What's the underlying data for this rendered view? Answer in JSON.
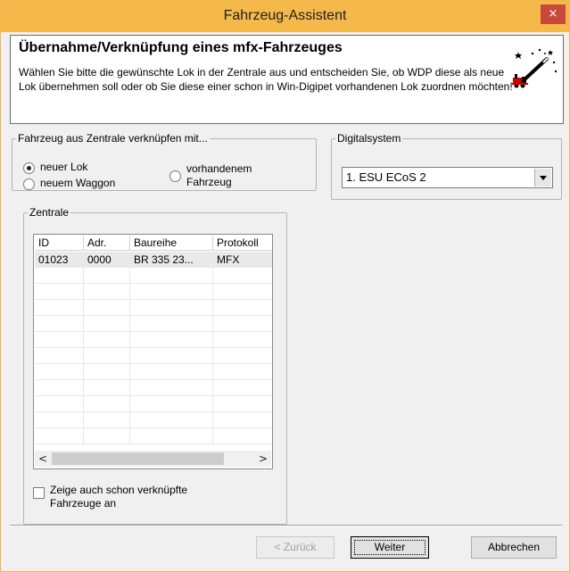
{
  "window": {
    "title": "Fahrzeug-Assistent",
    "close_label": "×"
  },
  "header": {
    "title": "Übernahme/Verknüpfung eines mfx-Fahrzeuges",
    "description": "Wählen Sie bitte die gewünschte Lok in der Zentrale aus und entscheiden Sie, ob WDP diese als neue Lok übernehmen soll oder ob Sie diese einer schon in Win-Digipet vorhandenen Lok zuordnen möchten!",
    "icon": "magic-wand-locomotive-icon"
  },
  "link_group": {
    "legend": "Fahrzeug aus Zentrale verknüpfen mit...",
    "options": [
      {
        "label": "neuer Lok",
        "selected": true
      },
      {
        "label": "neuem Waggon",
        "selected": false
      },
      {
        "label_line1": "vorhandenem",
        "label_line2": "Fahrzeug",
        "selected": false
      }
    ]
  },
  "digital_system": {
    "legend": "Digitalsystem",
    "selected": "1. ESU ECoS 2"
  },
  "central": {
    "legend": "Zentrale",
    "columns": [
      "ID",
      "Adr.",
      "Baureihe",
      "Protokoll"
    ],
    "rows": [
      [
        "01023",
        "0000",
        "BR 335 23...",
        "MFX"
      ]
    ],
    "scroll_left": "<",
    "scroll_right": ">"
  },
  "show_linked": {
    "line1": "Zeige auch schon verknüpfte",
    "line2": "Fahrzeuge an",
    "checked": false
  },
  "buttons": {
    "back": "< Zurück",
    "next": "Weiter",
    "cancel": "Abbrechen"
  }
}
